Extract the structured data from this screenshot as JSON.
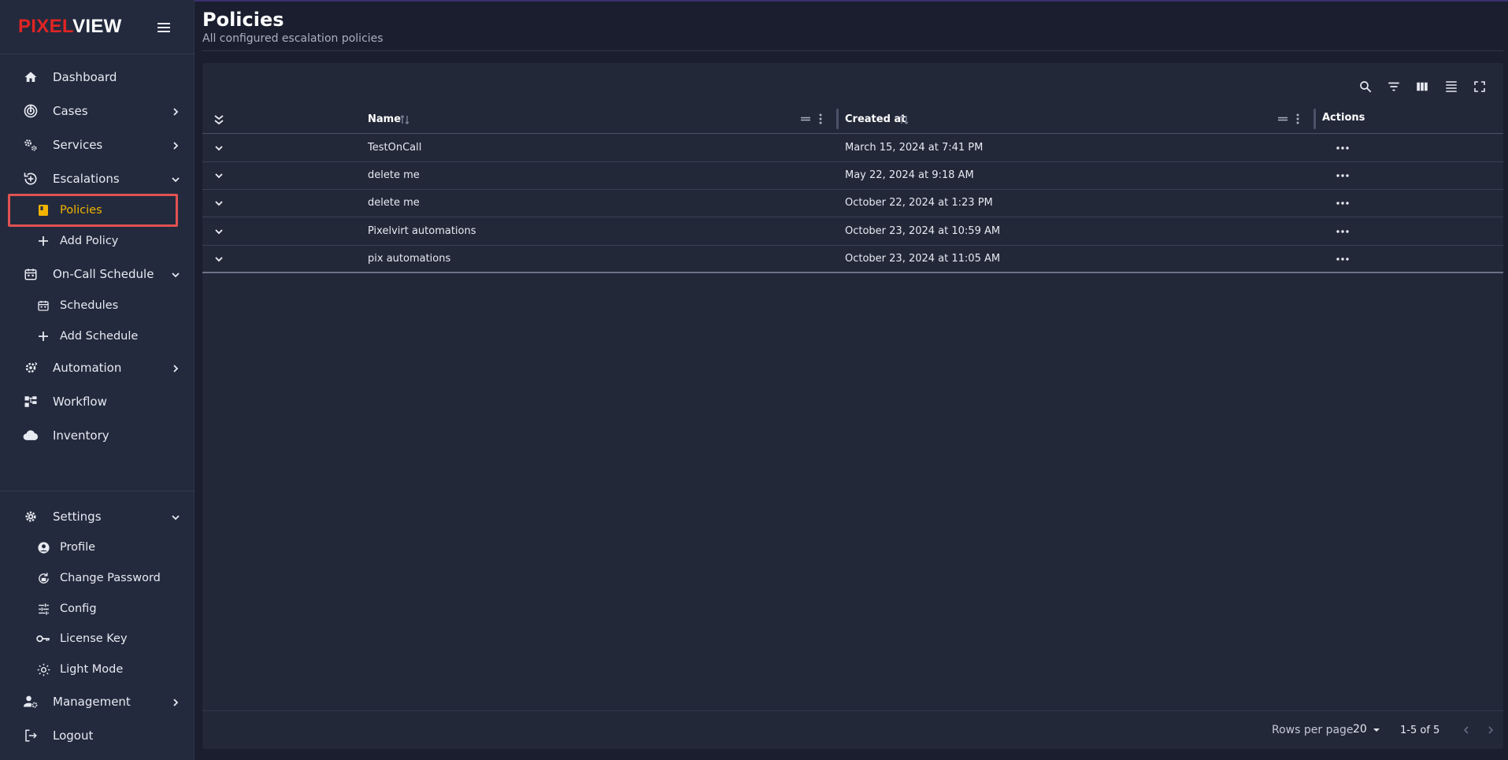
{
  "brand": {
    "part1": "PIXEL",
    "part2": "VIEW"
  },
  "sidebar": {
    "items": [
      {
        "label": "Dashboard"
      },
      {
        "label": "Cases"
      },
      {
        "label": "Services"
      },
      {
        "label": "Escalations"
      },
      {
        "label": "Policies"
      },
      {
        "label": "Add Policy"
      },
      {
        "label": "On-Call Schedule"
      },
      {
        "label": "Schedules"
      },
      {
        "label": "Add Schedule"
      },
      {
        "label": "Automation"
      },
      {
        "label": "Workflow"
      },
      {
        "label": "Inventory"
      }
    ],
    "bottom": [
      {
        "label": "Settings"
      },
      {
        "label": "Profile"
      },
      {
        "label": "Change Password"
      },
      {
        "label": "Config"
      },
      {
        "label": "License Key"
      },
      {
        "label": "Light Mode"
      },
      {
        "label": "Management"
      },
      {
        "label": "Logout"
      }
    ]
  },
  "page": {
    "title": "Policies",
    "subtitle": "All configured escalation policies"
  },
  "table": {
    "columns": {
      "name": "Name",
      "created": "Created at",
      "actions": "Actions"
    },
    "rows": [
      {
        "name": "TestOnCall",
        "created": "March 15, 2024 at 7:41 PM"
      },
      {
        "name": "delete me",
        "created": "May 22, 2024 at 9:18 AM"
      },
      {
        "name": "delete me",
        "created": "October 22, 2024 at 1:23 PM"
      },
      {
        "name": "Pixelvirt automations",
        "created": "October 23, 2024 at 10:59 AM"
      },
      {
        "name": "pix automations",
        "created": "October 23, 2024 at 11:05 AM"
      }
    ]
  },
  "pagination": {
    "rows_per_page_label": "Rows per page",
    "rows_per_page": "20",
    "range": "1-5 of 5"
  },
  "colors": {
    "accent": "#f2b400",
    "brand_red": "#e02424",
    "highlight_box": "#e05252"
  }
}
